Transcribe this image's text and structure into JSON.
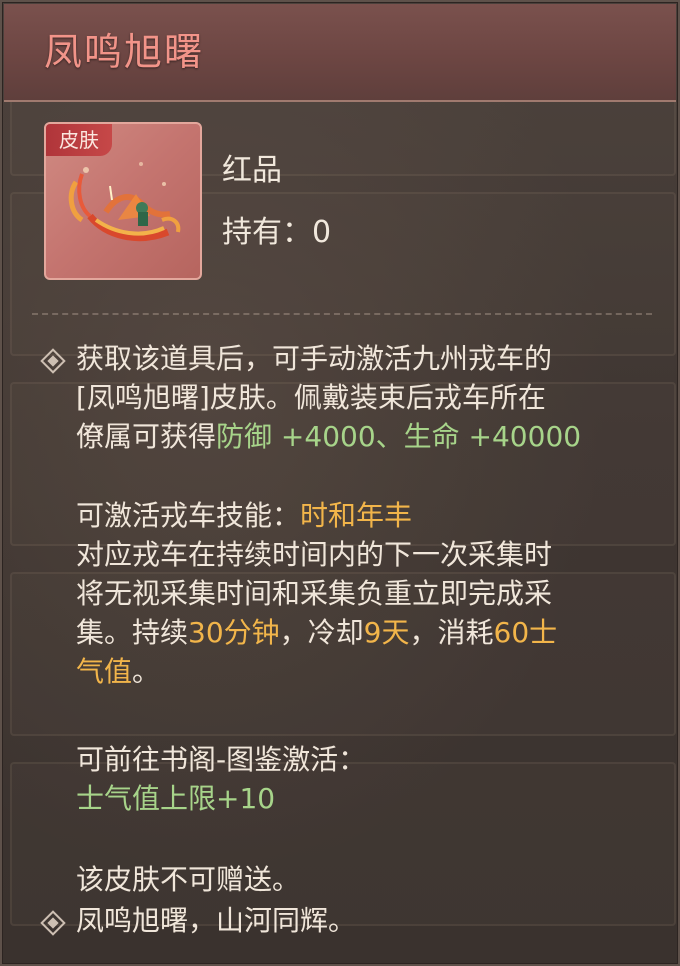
{
  "item": {
    "name": "凤鸣旭曙",
    "tag": "皮肤",
    "quality": "红品",
    "owned_label": "持有：",
    "owned_value": "0",
    "icon": "phoenix-mount-skin"
  },
  "description": {
    "line1": "获取该道具后，可手动激活九州戎车的",
    "line2": "[凤鸣旭曙]皮肤。佩戴装束后戎车所在",
    "line3_prefix": "僚属可获得",
    "line3_stats": "防御 +4000、生命 +40000",
    "skill_label": "可激活戎车技能：",
    "skill_name": "时和年丰",
    "skill_line1": "对应戎车在持续时间内的下一次采集时",
    "skill_line2": "将无视采集时间和采集负重立即完成采",
    "skill_line3_a": "集。持续",
    "skill_duration": "30分钟",
    "skill_line3_b": "，冷却",
    "skill_cooldown": "9天",
    "skill_line3_c": "，消耗",
    "skill_cost_a": "60士",
    "skill_cost_b": "气值",
    "skill_line4_end": "。",
    "codex_label": "可前往书阁-图鉴激活：",
    "codex_bonus": "士气值上限+10",
    "no_gift": "该皮肤不可赠送。",
    "flavor": "凤鸣旭曙，山河同辉。"
  },
  "colors": {
    "title": "#f29489",
    "stat_green": "#a7d48a",
    "highlight_orange": "#f2b54a",
    "text": "#f0e6da",
    "header_bg": "#6d4643"
  }
}
